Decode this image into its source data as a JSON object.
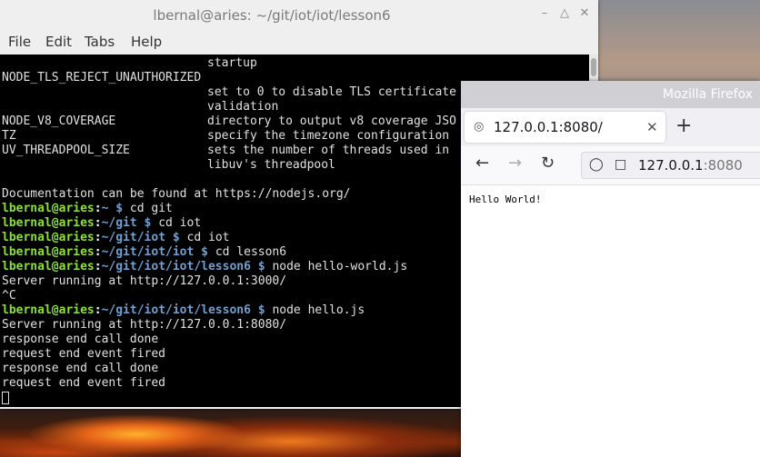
{
  "terminal": {
    "title": "lbernal@aries: ~/git/iot/iot/lesson6",
    "menu": [
      "File",
      "Edit",
      "Tabs",
      "Help"
    ],
    "env_lines": [
      {
        "name": "",
        "desc": "startup"
      },
      {
        "name": "NODE_TLS_REJECT_UNAUTHORIZED",
        "desc": ""
      },
      {
        "name": "",
        "desc": "set to 0 to disable TLS certificate"
      },
      {
        "name": "",
        "desc": "validation"
      },
      {
        "name": "NODE_V8_COVERAGE",
        "desc": "directory to output v8 coverage JSO"
      },
      {
        "name": "TZ",
        "desc": "specify the timezone configuration"
      },
      {
        "name": "UV_THREADPOOL_SIZE",
        "desc": "sets the number of threads used in"
      },
      {
        "name": "",
        "desc": "libuv's threadpool"
      }
    ],
    "doc_line": "Documentation can be found at https://nodejs.org/",
    "prompts": [
      {
        "user": "lbernal@aries",
        "path": "~",
        "cmd": "cd git"
      },
      {
        "user": "lbernal@aries",
        "path": "~/git",
        "cmd": "cd iot"
      },
      {
        "user": "lbernal@aries",
        "path": "~/git/iot",
        "cmd": "cd iot"
      },
      {
        "user": "lbernal@aries",
        "path": "~/git/iot/iot",
        "cmd": "cd lesson6"
      },
      {
        "user": "lbernal@aries",
        "path": "~/git/iot/iot/lesson6",
        "cmd": "node hello-world.js"
      }
    ],
    "output_1": "Server running at http://127.0.0.1:3000/",
    "ctrl_c": "^C",
    "prompt_2": {
      "user": "lbernal@aries",
      "path": "~/git/iot/iot/lesson6",
      "cmd": "node hello.js"
    },
    "output_2": [
      "Server running at http://127.0.0.1:8080/",
      "response end call done",
      "request end event fired",
      "response end call done",
      "request end event fired"
    ]
  },
  "firefox": {
    "title": "Mozilla Firefox",
    "tab_label": "127.0.0.1:8080/",
    "url_host": "127.0.0.1",
    "url_port": ":8080",
    "page_text": "Hello World!"
  },
  "icons": {
    "minimize": "minimize-icon",
    "maximize": "maximize-icon",
    "close": "close-icon",
    "back": "back-arrow-icon",
    "forward": "forward-arrow-icon",
    "reload": "reload-icon",
    "shield": "shield-icon",
    "page": "page-icon",
    "new_tab": "plus-icon",
    "favicon": "globe-icon"
  }
}
